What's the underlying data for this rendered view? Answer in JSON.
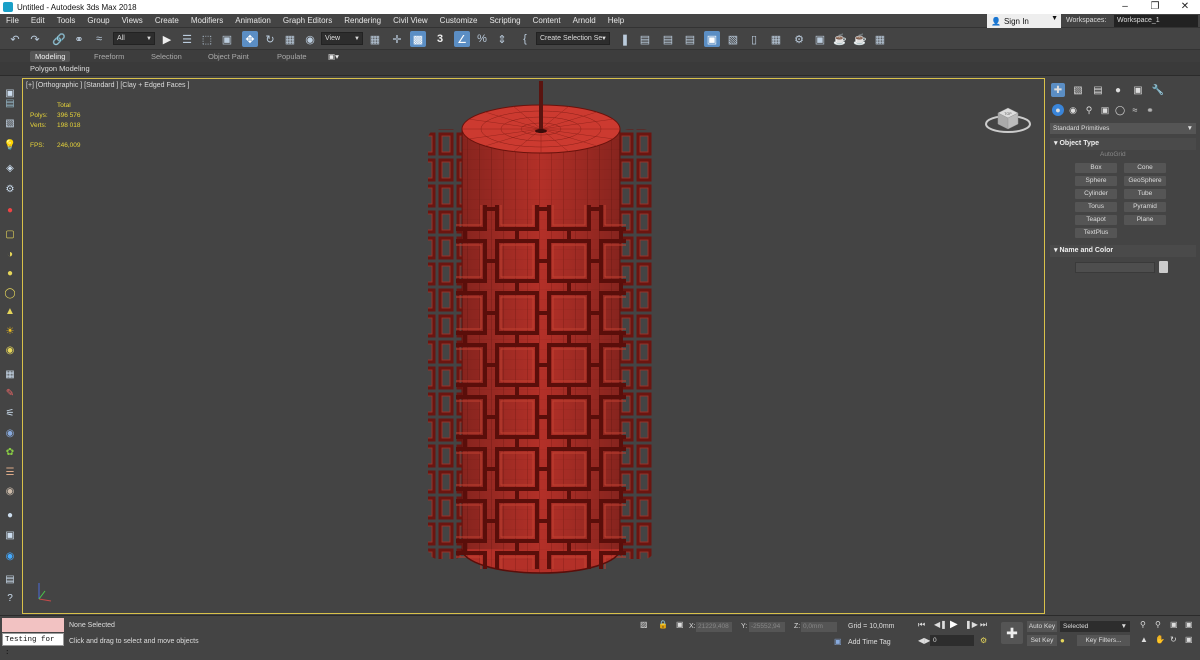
{
  "window": {
    "title": "Untitled - Autodesk 3ds Max 2018"
  },
  "menu": [
    "File",
    "Edit",
    "Tools",
    "Group",
    "Views",
    "Create",
    "Modifiers",
    "Animation",
    "Graph Editors",
    "Rendering",
    "Civil View",
    "Customize",
    "Scripting",
    "Content",
    "Arnold",
    "Help"
  ],
  "account": {
    "signin_label": "Sign In",
    "workspaces_label": "Workspaces:",
    "workspace_value": "Workspace_1"
  },
  "toolbar": {
    "selection_filter": "All",
    "ref_coord": "View",
    "named_selection": "Create Selection Se"
  },
  "ribbon": {
    "tabs": [
      "Modeling",
      "Freeform",
      "Selection",
      "Object Paint",
      "Populate"
    ],
    "active_tab": "Modeling",
    "panel_label": "Polygon Modeling"
  },
  "viewport": {
    "label": "[+] [Orthographic ] [Standard ] [Clay + Edged Faces ]",
    "stats": {
      "total_label": "Total",
      "polys_label": "Polys:",
      "polys_value": "396 576",
      "verts_label": "Verts:",
      "verts_value": "198 018",
      "fps_label": "FPS:",
      "fps_value": "246,009"
    },
    "viewcube_face": "TOP"
  },
  "command_panel": {
    "category": "Standard Primitives",
    "object_type_header": "Object Type",
    "autogrid_label": "AutoGrid",
    "buttons": [
      "Box",
      "Cone",
      "Sphere",
      "GeoSphere",
      "Cylinder",
      "Tube",
      "Torus",
      "Pyramid",
      "Teapot",
      "Plane",
      "TextPlus"
    ],
    "name_color_header": "Name and Color"
  },
  "status": {
    "maxscript_text": "Testing for :",
    "selection_text": "None Selected",
    "prompt_text": "Click and drag to select and move objects",
    "x_label": "X:",
    "x_value": "21229,408",
    "y_label": "Y:",
    "y_value": "-25552,94",
    "z_label": "Z:",
    "z_value": "0,0mm",
    "grid_text": "Grid = 10,0mm",
    "add_time_tag": "Add Time Tag",
    "frame_value": "0",
    "auto_key": "Auto Key",
    "set_key": "Set Key",
    "selected_combo": "Selected",
    "key_filters": "Key Filters..."
  }
}
